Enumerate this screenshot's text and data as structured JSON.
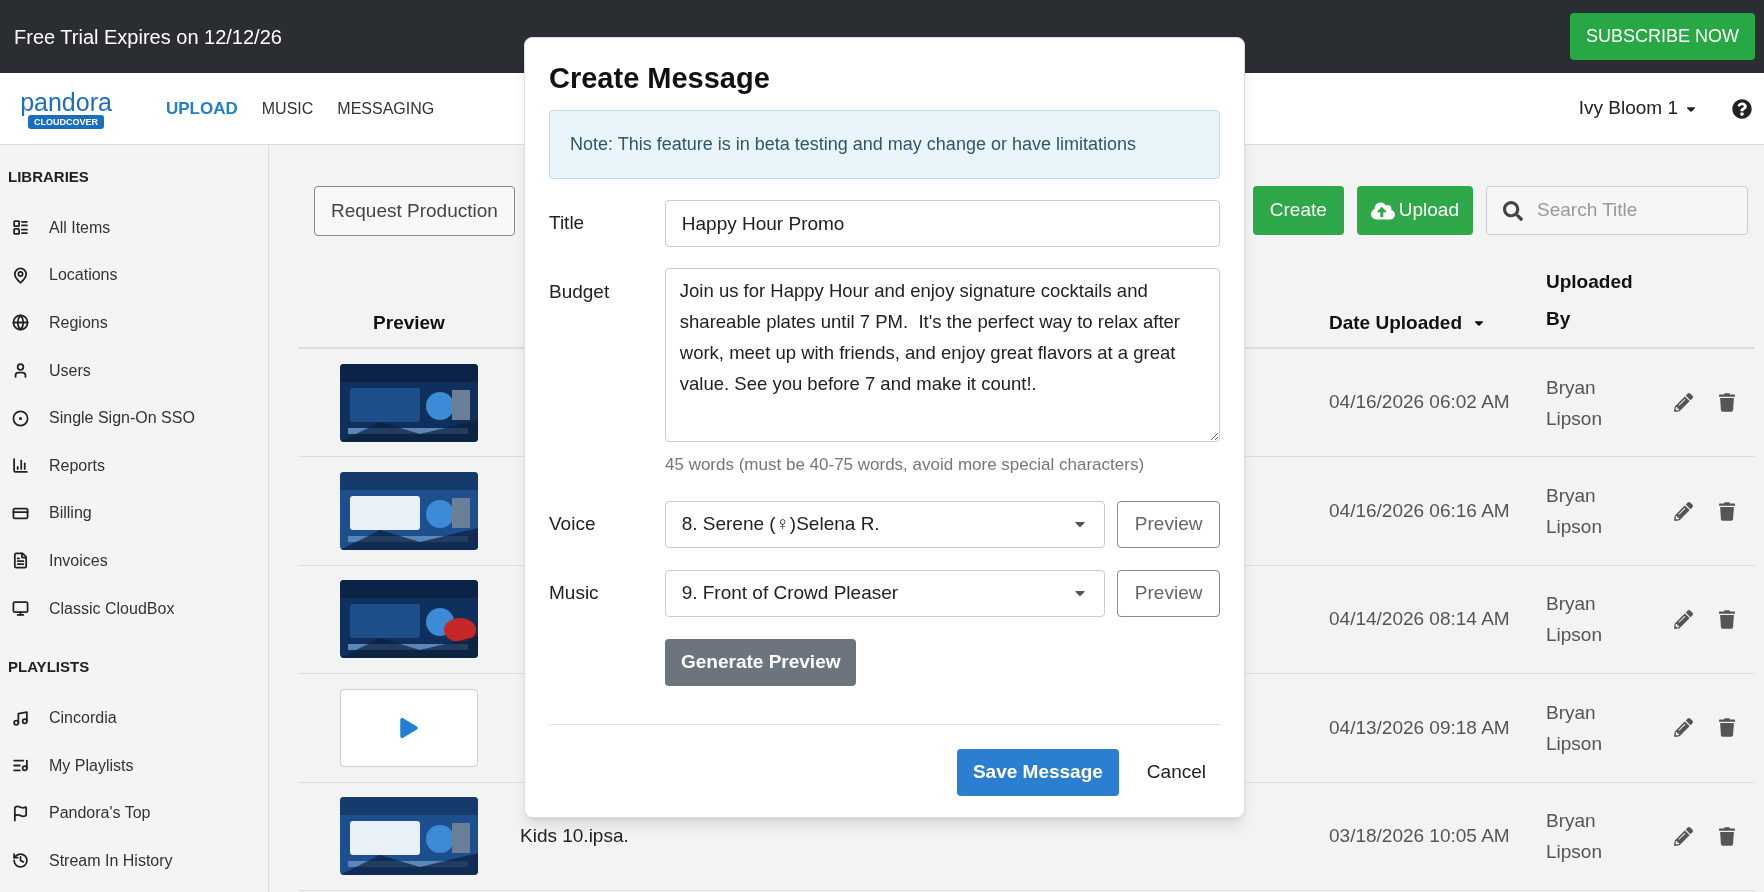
{
  "trial_bar": {
    "text": "Free Trial Expires on 12/12/26",
    "subscribe_button": "SUBSCRIBE NOW"
  },
  "nav": {
    "logo": {
      "wordmark": "pandora",
      "badge": "CLOUDCOVER"
    },
    "tabs": [
      {
        "label": "UPLOAD",
        "selected": true
      },
      {
        "label": "MUSIC",
        "selected": false
      },
      {
        "label": "MESSAGING",
        "selected": false
      }
    ],
    "user_menu": "Ivy Bloom 1"
  },
  "sidebar": {
    "sections": [
      {
        "heading": "LIBRARIES",
        "items": [
          "All Items",
          "Locations",
          "Regions",
          "Users",
          "Single Sign-On SSO",
          "Reports",
          "Billing",
          "Invoices",
          "Classic CloudBox"
        ]
      },
      {
        "heading": "PLAYLISTS",
        "items": [
          "Cincordia",
          "My Playlists",
          "Pandora's Top",
          "Stream In History"
        ]
      }
    ]
  },
  "toolbar": {
    "request_button": "Request Production",
    "create_button": "Create",
    "upload_button": "Upload",
    "search": {
      "placeholder": "Search Title"
    }
  },
  "table": {
    "columns": [
      "Preview",
      "Date Uploaded",
      "Uploaded By"
    ],
    "rows": [
      {
        "date": "04/16/2026 06:02 AM",
        "uploaded_by": "Bryan Lipson"
      },
      {
        "date": "04/16/2026 06:16 AM",
        "uploaded_by": "Bryan Lipson"
      },
      {
        "date": "04/14/2026 08:14 AM",
        "uploaded_by": "Bryan Lipson"
      },
      {
        "thumbnail": {
          "kind": "video"
        },
        "date": "04/13/2026 09:18 AM",
        "uploaded_by": "Bryan Lipson"
      },
      {
        "title": "Kids 10.ipsa.",
        "date": "03/18/2026 10:05 AM",
        "uploaded_by": "Bryan Lipson"
      }
    ]
  },
  "modal": {
    "title": "Create Message",
    "note": "Note: This feature is in beta testing and may change or have limitations",
    "fields": {
      "title": {
        "label": "Title",
        "value": "Happy Hour Promo"
      },
      "budget": {
        "label": "Budget",
        "value": "Join us for Happy Hour and enjoy signature cocktails and shareable plates until 7 PM.  It's the perfect way to relax after work, meet up with friends, and enjoy great flavors at a great value. See you before 7 and make it count!.",
        "hint": "45 words (must be 40-75 words, avoid more special characters)"
      },
      "voice": {
        "label": "Voice",
        "value": "8. Serene (♀)Selena R.",
        "preview_button": "Preview"
      },
      "music": {
        "label": "Music",
        "value": "9. Front of Crowd Pleaser",
        "preview_button": "Preview"
      }
    },
    "generate_button": "Generate Preview",
    "save_button": "Save Message",
    "cancel_button": "Cancel"
  }
}
